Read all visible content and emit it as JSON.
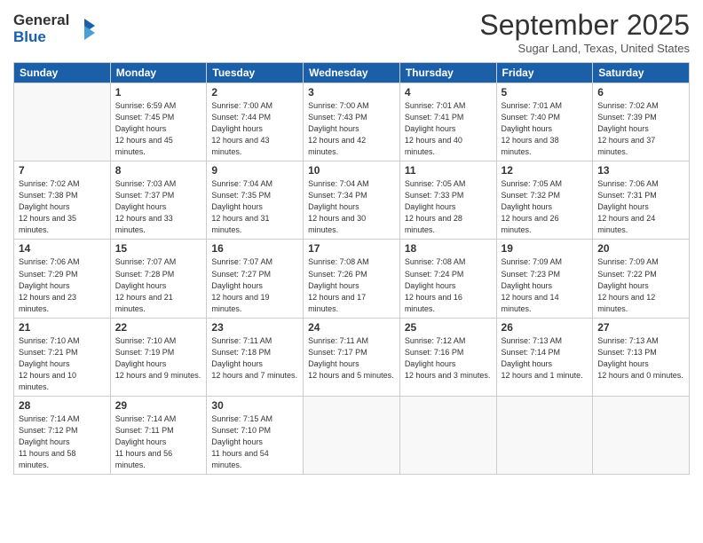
{
  "header": {
    "logo_line1": "General",
    "logo_line2": "Blue",
    "month": "September 2025",
    "location": "Sugar Land, Texas, United States"
  },
  "weekdays": [
    "Sunday",
    "Monday",
    "Tuesday",
    "Wednesday",
    "Thursday",
    "Friday",
    "Saturday"
  ],
  "weeks": [
    [
      {
        "day": "",
        "empty": true
      },
      {
        "day": "1",
        "rise": "6:59 AM",
        "set": "7:45 PM",
        "daylight": "12 hours and 45 minutes."
      },
      {
        "day": "2",
        "rise": "7:00 AM",
        "set": "7:44 PM",
        "daylight": "12 hours and 43 minutes."
      },
      {
        "day": "3",
        "rise": "7:00 AM",
        "set": "7:43 PM",
        "daylight": "12 hours and 42 minutes."
      },
      {
        "day": "4",
        "rise": "7:01 AM",
        "set": "7:41 PM",
        "daylight": "12 hours and 40 minutes."
      },
      {
        "day": "5",
        "rise": "7:01 AM",
        "set": "7:40 PM",
        "daylight": "12 hours and 38 minutes."
      },
      {
        "day": "6",
        "rise": "7:02 AM",
        "set": "7:39 PM",
        "daylight": "12 hours and 37 minutes."
      }
    ],
    [
      {
        "day": "7",
        "rise": "7:02 AM",
        "set": "7:38 PM",
        "daylight": "12 hours and 35 minutes."
      },
      {
        "day": "8",
        "rise": "7:03 AM",
        "set": "7:37 PM",
        "daylight": "12 hours and 33 minutes."
      },
      {
        "day": "9",
        "rise": "7:04 AM",
        "set": "7:35 PM",
        "daylight": "12 hours and 31 minutes."
      },
      {
        "day": "10",
        "rise": "7:04 AM",
        "set": "7:34 PM",
        "daylight": "12 hours and 30 minutes."
      },
      {
        "day": "11",
        "rise": "7:05 AM",
        "set": "7:33 PM",
        "daylight": "12 hours and 28 minutes."
      },
      {
        "day": "12",
        "rise": "7:05 AM",
        "set": "7:32 PM",
        "daylight": "12 hours and 26 minutes."
      },
      {
        "day": "13",
        "rise": "7:06 AM",
        "set": "7:31 PM",
        "daylight": "12 hours and 24 minutes."
      }
    ],
    [
      {
        "day": "14",
        "rise": "7:06 AM",
        "set": "7:29 PM",
        "daylight": "12 hours and 23 minutes."
      },
      {
        "day": "15",
        "rise": "7:07 AM",
        "set": "7:28 PM",
        "daylight": "12 hours and 21 minutes."
      },
      {
        "day": "16",
        "rise": "7:07 AM",
        "set": "7:27 PM",
        "daylight": "12 hours and 19 minutes."
      },
      {
        "day": "17",
        "rise": "7:08 AM",
        "set": "7:26 PM",
        "daylight": "12 hours and 17 minutes."
      },
      {
        "day": "18",
        "rise": "7:08 AM",
        "set": "7:24 PM",
        "daylight": "12 hours and 16 minutes."
      },
      {
        "day": "19",
        "rise": "7:09 AM",
        "set": "7:23 PM",
        "daylight": "12 hours and 14 minutes."
      },
      {
        "day": "20",
        "rise": "7:09 AM",
        "set": "7:22 PM",
        "daylight": "12 hours and 12 minutes."
      }
    ],
    [
      {
        "day": "21",
        "rise": "7:10 AM",
        "set": "7:21 PM",
        "daylight": "12 hours and 10 minutes."
      },
      {
        "day": "22",
        "rise": "7:10 AM",
        "set": "7:19 PM",
        "daylight": "12 hours and 9 minutes."
      },
      {
        "day": "23",
        "rise": "7:11 AM",
        "set": "7:18 PM",
        "daylight": "12 hours and 7 minutes."
      },
      {
        "day": "24",
        "rise": "7:11 AM",
        "set": "7:17 PM",
        "daylight": "12 hours and 5 minutes."
      },
      {
        "day": "25",
        "rise": "7:12 AM",
        "set": "7:16 PM",
        "daylight": "12 hours and 3 minutes."
      },
      {
        "day": "26",
        "rise": "7:13 AM",
        "set": "7:14 PM",
        "daylight": "12 hours and 1 minute."
      },
      {
        "day": "27",
        "rise": "7:13 AM",
        "set": "7:13 PM",
        "daylight": "12 hours and 0 minutes."
      }
    ],
    [
      {
        "day": "28",
        "rise": "7:14 AM",
        "set": "7:12 PM",
        "daylight": "11 hours and 58 minutes."
      },
      {
        "day": "29",
        "rise": "7:14 AM",
        "set": "7:11 PM",
        "daylight": "11 hours and 56 minutes."
      },
      {
        "day": "30",
        "rise": "7:15 AM",
        "set": "7:10 PM",
        "daylight": "11 hours and 54 minutes."
      },
      {
        "day": "",
        "empty": true
      },
      {
        "day": "",
        "empty": true
      },
      {
        "day": "",
        "empty": true
      },
      {
        "day": "",
        "empty": true
      }
    ]
  ]
}
